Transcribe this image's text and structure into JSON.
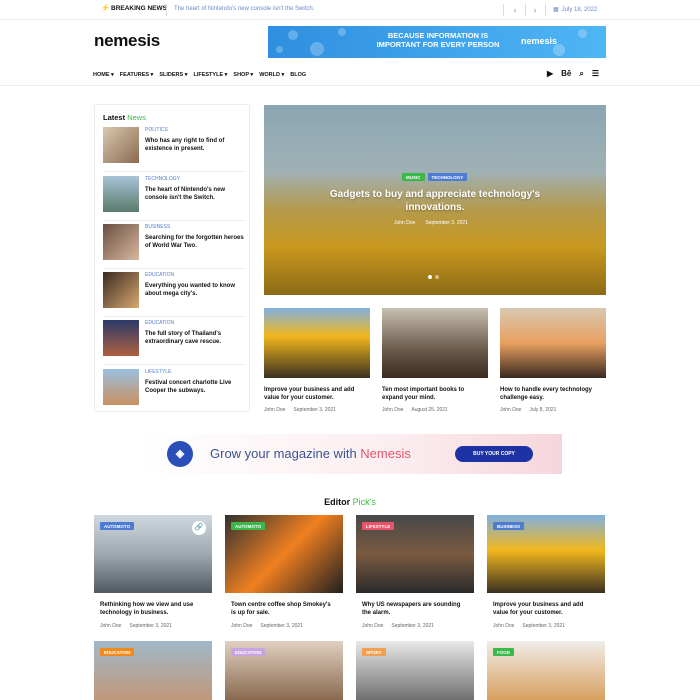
{
  "topbar": {
    "breaking_label": "BREAKING NEWS",
    "ticker": "The heart of Nintendo's new console isn't the Switch.",
    "date": "July 18, 2022"
  },
  "header": {
    "logo": "nemesis",
    "banner_text": "Because information is important for every person",
    "banner_logo": "nemesis"
  },
  "nav": {
    "items": [
      "HOME",
      "FEATURES",
      "SLIDERS",
      "LIFESTYLE",
      "SHOP",
      "WORLD",
      "BLOG"
    ]
  },
  "latest": {
    "title_a": "Latest",
    "title_b": "News",
    "items": [
      {
        "cat": "POLITICS",
        "title": "Who has any right to find of existence in present."
      },
      {
        "cat": "TECHNOLOGY",
        "title": "The heart of Nintendo's new console isn't the Switch."
      },
      {
        "cat": "BUSINESS",
        "title": "Searching for the forgotten heroes of World War Two."
      },
      {
        "cat": "EDUCATION",
        "title": "Everything you wanted to know about mega city's."
      },
      {
        "cat": "EDUCATION",
        "title": "The full story of Thailand's extraordinary cave rescue."
      },
      {
        "cat": "LIFESTYLE",
        "title": "Festival concert charlotte Live Cooper the subways."
      }
    ]
  },
  "hero": {
    "tags": [
      "MUSIC",
      "TECHNOLOGY"
    ],
    "title": "Gadgets to buy and appreciate technology's innovations.",
    "author": "John Doe",
    "date": "September 3, 2021"
  },
  "cards": [
    {
      "title": "Improve your business and add value for your customer.",
      "author": "John Doe",
      "date": "September 3, 2021"
    },
    {
      "title": "Ten most important books to expand your mind.",
      "author": "John Doe",
      "date": "August 25, 2021"
    },
    {
      "title": "How to handle every technology challenge easy.",
      "author": "John Doe",
      "date": "July 8, 2021"
    }
  ],
  "ad": {
    "text_a": "Grow your magazine with",
    "text_b": "Nemesis",
    "button": "BUY YOUR COPY"
  },
  "editor": {
    "title_a": "Editor",
    "title_b": "Pick's",
    "row1": [
      {
        "tag": "AUTOMOTO",
        "title": "Rethinking how we view and use technology in business.",
        "author": "John Doe",
        "date": "September 3, 2021"
      },
      {
        "tag": "AUTOMOTO",
        "title": "Town centre coffee shop Smokey's is up for sale.",
        "author": "John Doe",
        "date": "September 3, 2021"
      },
      {
        "tag": "LIFESTYLE",
        "title": "Why US newspapers are sounding the alarm.",
        "author": "John Doe",
        "date": "September 3, 2021"
      },
      {
        "tag": "BUSINESS",
        "title": "Improve your business and add value for your customer.",
        "author": "John Doe",
        "date": "September 3, 2021"
      }
    ],
    "row2": [
      {
        "tag": "EDUCATION"
      },
      {
        "tag": "EDUCATION"
      },
      {
        "tag": "SPORT"
      },
      {
        "tag": "FOOD"
      }
    ]
  },
  "colors": {
    "accent_green": "#3bb84a",
    "accent_blue": "#4f7cd3",
    "orange": "#f05a28"
  }
}
